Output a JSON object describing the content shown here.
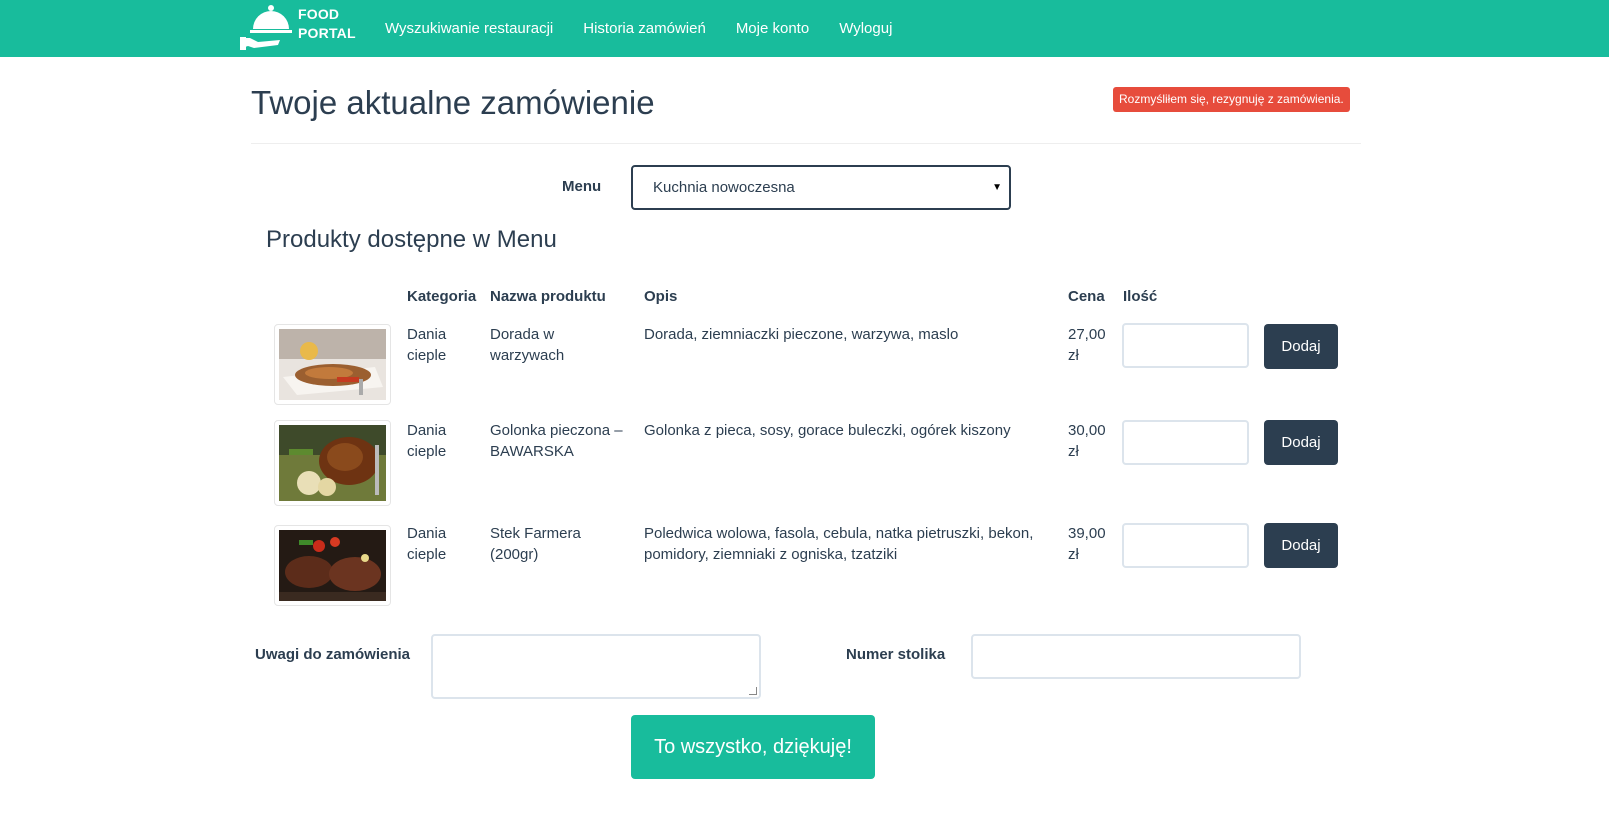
{
  "brand": {
    "line1": "FOOD",
    "line2": "PORTAL"
  },
  "nav": [
    {
      "label": "Wyszukiwanie restauracji"
    },
    {
      "label": "Historia zamówień"
    },
    {
      "label": "Moje konto"
    },
    {
      "label": "Wyloguj"
    }
  ],
  "page_title": "Twoje aktualne zamówienie",
  "cancel_label": "Rozmyśliłem się, rezygnuję z zamówienia.",
  "menu": {
    "label": "Menu",
    "selected": "Kuchnia nowoczesna"
  },
  "section_title": "Produkty dostępne w Menu",
  "table": {
    "headers": {
      "category": "Kategoria",
      "name": "Nazwa produktu",
      "description": "Opis",
      "price": "Cena",
      "quantity": "Ilość"
    },
    "rows": [
      {
        "category_1": "Dania",
        "category_2": "cieple",
        "name_1": "Dorada w",
        "name_2": "warzywach",
        "description_1": "Dorada, ziemniaczki pieczone, warzywa, maslo",
        "description_2": "",
        "price_1": "27,00",
        "price_2": "zł",
        "image": "fish-dish-photo",
        "add_label": "Dodaj"
      },
      {
        "category_1": "Dania",
        "category_2": "cieple",
        "name_1": "Golonka pieczona –",
        "name_2": "BAWARSKA",
        "description_1": "Golonka z pieca, sosy, gorace buleczki, ogórek kiszony",
        "description_2": "",
        "price_1": "30,00",
        "price_2": "zł",
        "image": "pork-knuckle-photo",
        "add_label": "Dodaj"
      },
      {
        "category_1": "Dania",
        "category_2": "cieple",
        "name_1": "Stek Farmera",
        "name_2": "(200gr)",
        "description_1": "Poledwica wolowa, fasola, cebula, natka pietruszki, bekon,",
        "description_2": "pomidory, ziemniaki z ogniska, tzatziki",
        "price_1": "39,00",
        "price_2": "zł",
        "image": "steak-photo",
        "add_label": "Dodaj"
      }
    ]
  },
  "notes_label": "Uwagi do zamówienia",
  "table_number_label": "Numer stolika",
  "submit_label": "To wszystko, dziękuję!",
  "colors": {
    "primary": "#18bc9c",
    "dark": "#2c3e50",
    "danger": "#e74c3c",
    "border": "#dce4ec"
  }
}
